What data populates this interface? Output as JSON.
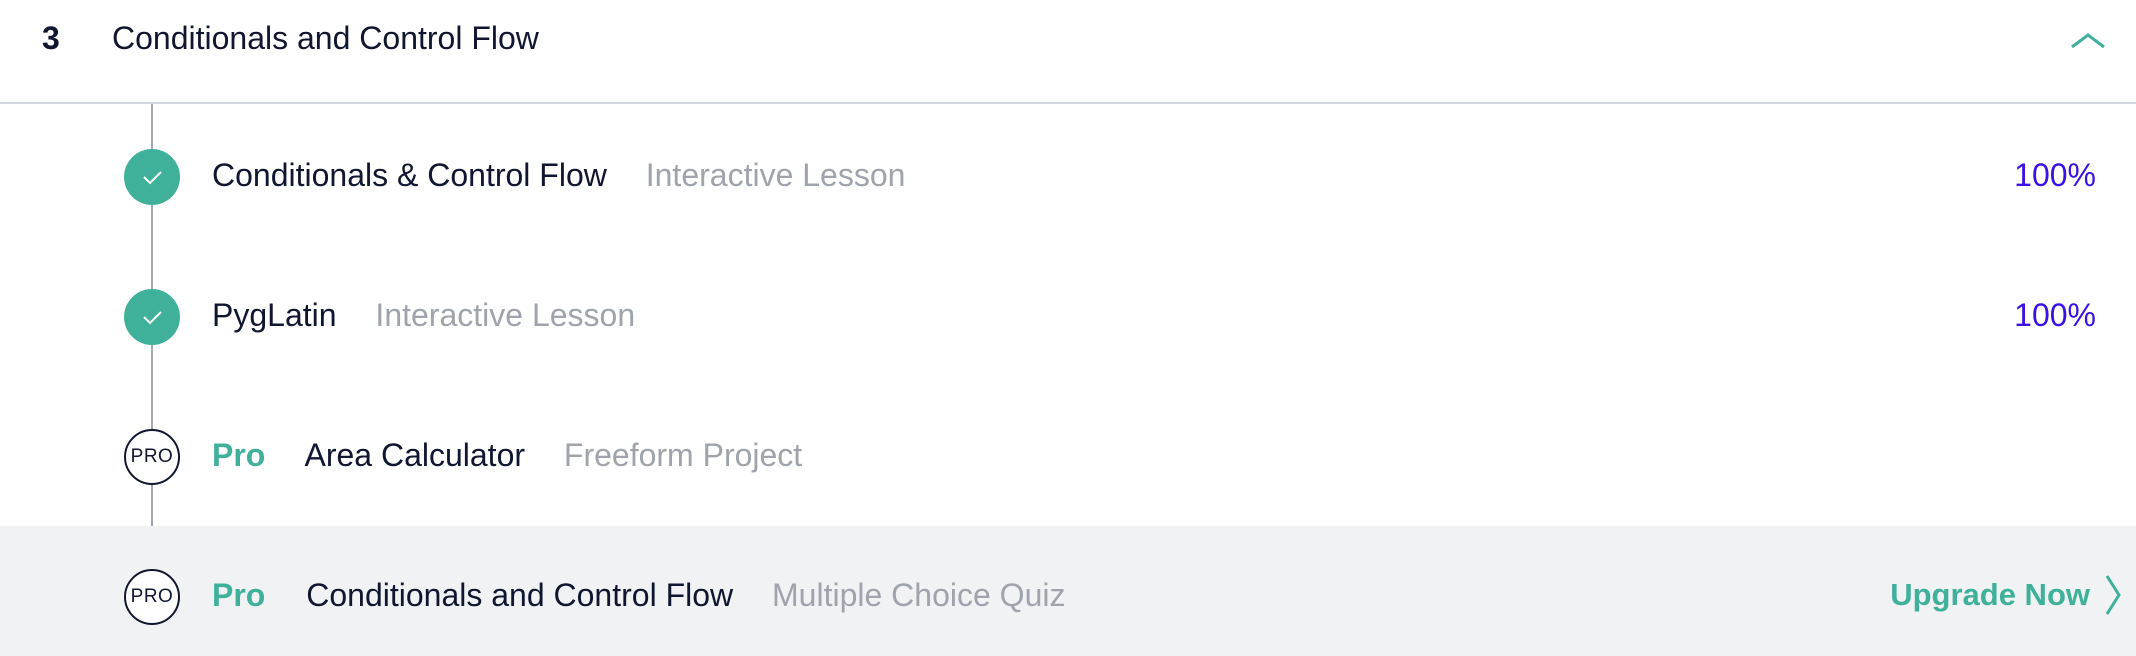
{
  "module": {
    "number": "3",
    "title": "Conditionals and Control Flow"
  },
  "lessons": [
    {
      "status": "complete",
      "title": "Conditionals & Control Flow",
      "type": "Interactive Lesson",
      "progress": "100%"
    },
    {
      "status": "complete",
      "title": "PygLatin",
      "type": "Interactive Lesson",
      "progress": "100%"
    },
    {
      "status": "locked",
      "badge": "PRO",
      "pro_label": "Pro",
      "title": "Area Calculator",
      "type": "Freeform Project"
    },
    {
      "status": "locked",
      "badge": "PRO",
      "pro_label": "Pro",
      "title": "Conditionals and Control Flow",
      "type": "Multiple Choice Quiz",
      "action": "Upgrade Now"
    }
  ],
  "colors": {
    "accent_green": "#3fb09a",
    "progress_purple": "#3a10e5",
    "text_dark": "#10162f",
    "text_muted": "#9fa3ab",
    "row_highlight": "#f0f2f4"
  },
  "icons": {
    "collapse": "chevron-up-icon",
    "complete": "checkmark-icon",
    "upgrade": "chevron-right-icon"
  }
}
